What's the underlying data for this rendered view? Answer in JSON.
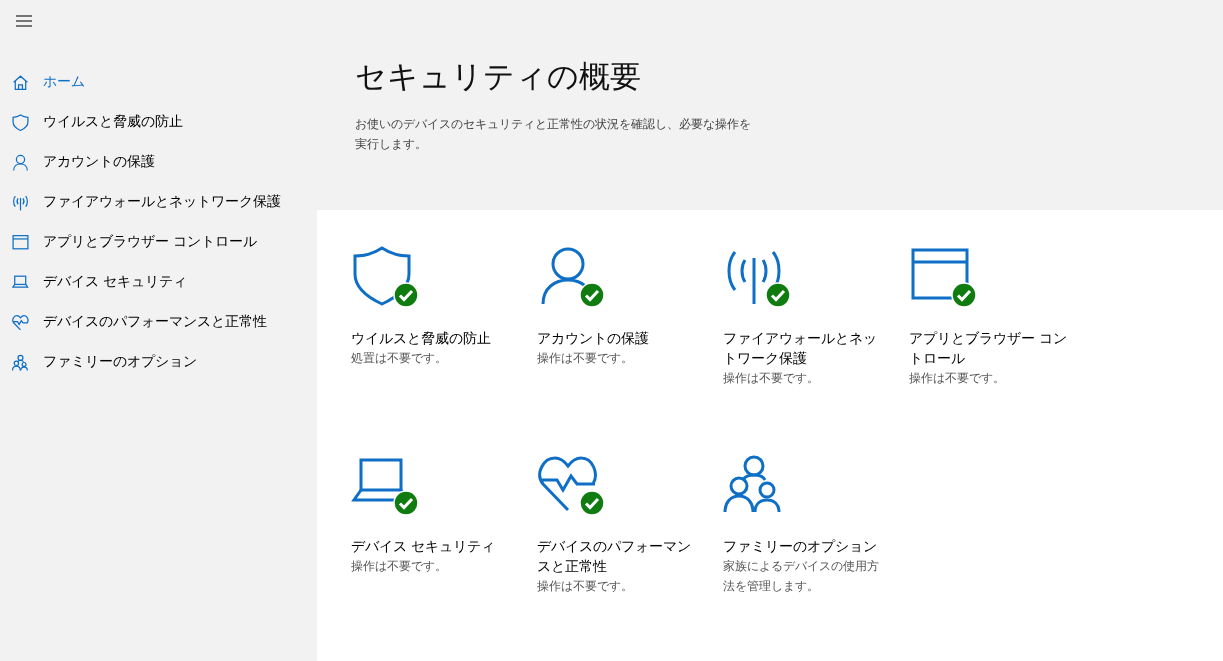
{
  "sidebar": {
    "items": [
      {
        "label": "ホーム",
        "kind": "home",
        "selected": true
      },
      {
        "label": "ウイルスと脅威の防止",
        "kind": "shield",
        "selected": false
      },
      {
        "label": "アカウントの保護",
        "kind": "person",
        "selected": false
      },
      {
        "label": "ファイアウォールとネットワーク保護",
        "kind": "antenna",
        "selected": false
      },
      {
        "label": "アプリとブラウザー コントロール",
        "kind": "browser",
        "selected": false
      },
      {
        "label": "デバイス セキュリティ",
        "kind": "laptop",
        "selected": false
      },
      {
        "label": "デバイスのパフォーマンスと正常性",
        "kind": "heart",
        "selected": false
      },
      {
        "label": "ファミリーのオプション",
        "kind": "family",
        "selected": false
      }
    ]
  },
  "header": {
    "title": "セキュリティの概要",
    "description": "お使いのデバイスのセキュリティと正常性の状況を確認し、必要な操作を実行します。"
  },
  "tiles": [
    {
      "title": "ウイルスと脅威の防止",
      "status": "処置は不要です。",
      "kind": "shield",
      "checked": true
    },
    {
      "title": "アカウントの保護",
      "status": "操作は不要です。",
      "kind": "person",
      "checked": true
    },
    {
      "title": "ファイアウォールとネットワーク保護",
      "status": "操作は不要です。",
      "kind": "antenna",
      "checked": true
    },
    {
      "title": "アプリとブラウザー コントロール",
      "status": "操作は不要です。",
      "kind": "browser",
      "checked": true
    },
    {
      "title": "デバイス セキュリティ",
      "status": "操作は不要です。",
      "kind": "laptop",
      "checked": true
    },
    {
      "title": "デバイスのパフォーマンスと正常性",
      "status": "操作は不要です。",
      "kind": "heart",
      "checked": true
    },
    {
      "title": "ファミリーのオプション",
      "status": "家族によるデバイスの使用方法を管理します。",
      "kind": "family",
      "checked": false
    }
  ]
}
